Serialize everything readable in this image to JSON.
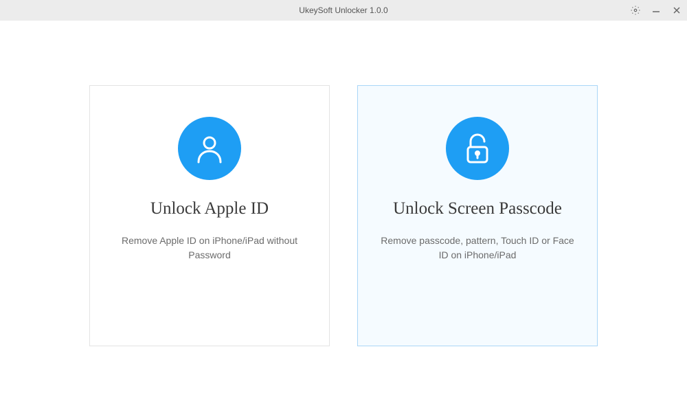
{
  "window": {
    "title": "UkeySoft Unlocker 1.0.0"
  },
  "options": {
    "appleId": {
      "title": "Unlock Apple ID",
      "description": "Remove Apple ID on iPhone/iPad without Password"
    },
    "screenPasscode": {
      "title": "Unlock Screen Passcode",
      "description": "Remove passcode, pattern, Touch ID or Face ID on iPhone/iPad"
    }
  }
}
